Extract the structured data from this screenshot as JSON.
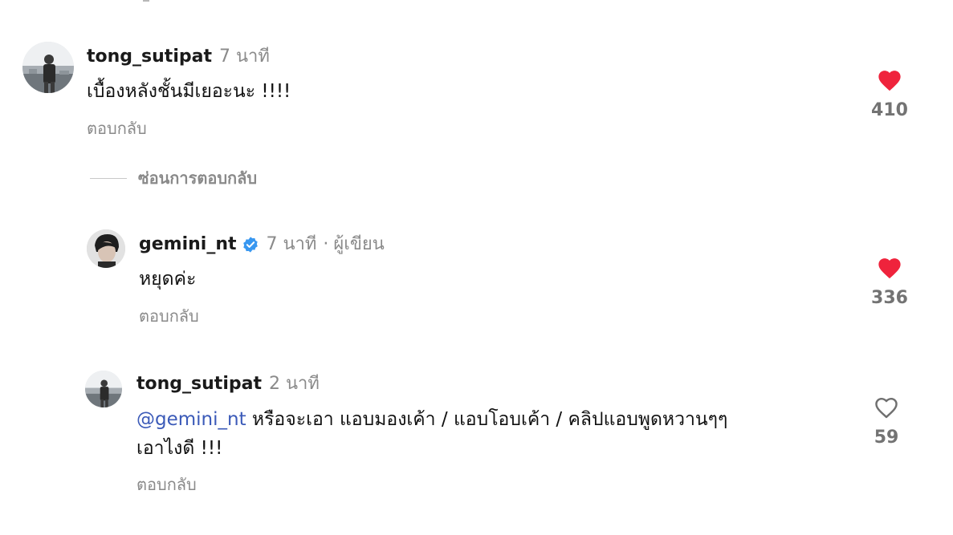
{
  "comments": [
    {
      "username": "tong_sutipat",
      "time": "7 นาที",
      "text": "เบื้องหลังชั้นมีเยอะนะ !!!!",
      "reply_label": "ตอบกลับ",
      "likes": "410",
      "liked": true
    },
    {
      "username": "gemini_nt",
      "verified": true,
      "time": "7 นาที",
      "author_tag": "ผู้เขียน",
      "text": "หยุดค่ะ",
      "reply_label": "ตอบกลับ",
      "likes": "336",
      "liked": true
    },
    {
      "username": "tong_sutipat",
      "time": "2 นาที",
      "mention": "@gemini_nt",
      "text_line1": "หรือจะเอา แอบมองเค้า / แอบโอบเค้า / คลิปแอบพูดหวานๆๆ",
      "text_line2": "เอาไงดี !!!",
      "reply_label": "ตอบกลับ",
      "likes": "59",
      "liked": false
    }
  ],
  "hide_replies_label": "ซ่อนการตอบกลับ",
  "colors": {
    "liked_heart": "#ef233c",
    "mention": "#3b5ab8",
    "verified": "#3897f0",
    "secondary_text": "#8a8a8a"
  }
}
